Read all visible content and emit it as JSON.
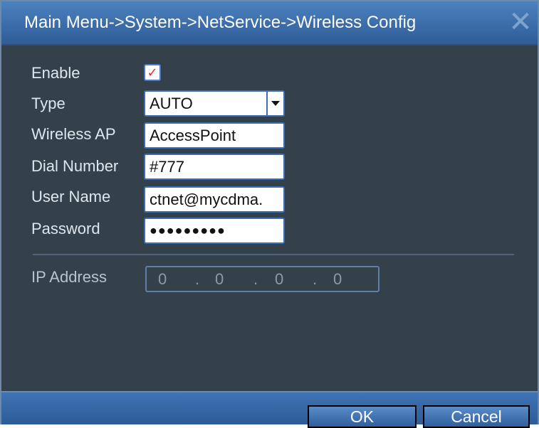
{
  "window": {
    "title": "Main Menu->System->NetService->Wireless Config",
    "close_symbol": "✕"
  },
  "form": {
    "enable": {
      "label": "Enable",
      "checked": true,
      "check_mark": "✓"
    },
    "type": {
      "label": "Type",
      "value": "AUTO"
    },
    "wireless_ap": {
      "label": "Wireless AP",
      "value": "AccessPoint"
    },
    "dial_number": {
      "label": "Dial Number",
      "value": "#777"
    },
    "user_name": {
      "label": "User Name",
      "value": "ctnet@mycdma."
    },
    "password": {
      "label": "Password",
      "masked": "●●●●●●●●●"
    }
  },
  "ip": {
    "label": "IP Address",
    "octets": [
      "0",
      "0",
      "0",
      "0"
    ],
    "separator": "."
  },
  "buttons": {
    "ok": "OK",
    "cancel": "Cancel"
  },
  "colors": {
    "titlebar": "#3a6ba8",
    "panel": "#34414a",
    "field_border": "#3b6eb4",
    "check": "#e03030"
  }
}
